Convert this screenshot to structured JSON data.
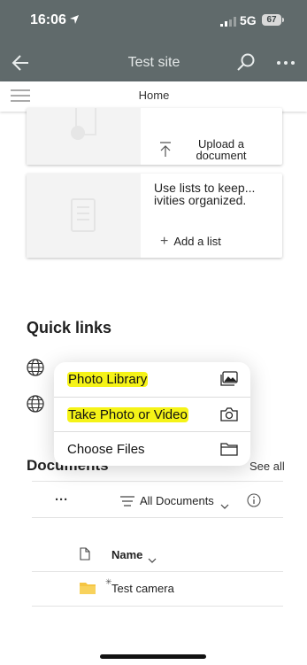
{
  "status_bar": {
    "time": "16:06",
    "network": "5G",
    "battery": "67"
  },
  "header": {
    "title": "Test site"
  },
  "nav": {
    "current": "Home"
  },
  "cards": [
    {
      "action_label": "Upload a document"
    },
    {
      "description": "Use lists to keep... ivities organized.",
      "action_label": "Add a list"
    }
  ],
  "quick_links": {
    "title": "Quick links"
  },
  "action_sheet": {
    "items": [
      {
        "label": "Photo Library",
        "icon": "photo-library-icon"
      },
      {
        "label": "Take Photo or Video",
        "icon": "camera-icon"
      },
      {
        "label": "Choose Files",
        "icon": "folder-icon"
      }
    ]
  },
  "documents": {
    "title": "Documents",
    "see_all": "See all",
    "more": "···",
    "view": "All Documents",
    "columns": {
      "name": "Name"
    },
    "files": [
      {
        "name": "Test camera",
        "type": "folder"
      }
    ]
  },
  "colors": {
    "overlay": "#606a6b",
    "highlight": "#f5f317",
    "folder": "#f5c543"
  }
}
